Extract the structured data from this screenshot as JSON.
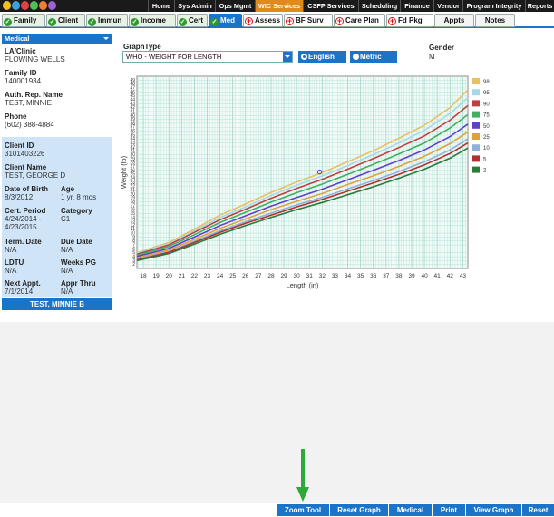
{
  "topnav": [
    "Home",
    "Sys Admin",
    "Ops Mgmt",
    "WIC Services",
    "CSFP Services",
    "Scheduling",
    "Finance",
    "Vendor",
    "Program Integrity",
    "Reports"
  ],
  "tabs": [
    "Family",
    "Client",
    "Immun",
    "Income",
    "Cert",
    "Med",
    "Assess",
    "BF Surv",
    "Care Plan",
    "Fd Pkg",
    "Appts",
    "Notes"
  ],
  "sidebar": {
    "header": "Medical",
    "la_label": "LA/Clinic",
    "la_value": "FLOWING WELLS",
    "family_label": "Family ID",
    "family_value": "140001934",
    "auth_label": "Auth. Rep. Name",
    "auth_value": "TEST, MINNIE",
    "phone_label": "Phone",
    "phone_value": "(602) 388-4884",
    "client_id_label": "Client ID",
    "client_id_value": "3101403226",
    "client_name_label": "Client Name",
    "client_name_value": "TEST, GEORGE D",
    "dob_label": "Date of Birth",
    "dob_value": "8/3/2012",
    "age_label": "Age",
    "age_value": "1 yr, 8 mos",
    "cert_label": "Cert. Period",
    "cert_value1": "4/24/2014 -",
    "cert_value2": "4/23/2015",
    "category_label": "Category",
    "category_value": "C1",
    "term_label": "Term. Date",
    "term_value": "N/A",
    "due_label": "Due Date",
    "due_value": "N/A",
    "ldtu_label": "LDTU",
    "ldtu_value": "N/A",
    "weeks_label": "Weeks PG",
    "weeks_value": "N/A",
    "next_label": "Next Appt.",
    "next_value": "7/1/2014",
    "appr_label": "Appr Thru",
    "appr_value": "N/A",
    "footer": "TEST, MINNIE B"
  },
  "main": {
    "graphtype_label": "GraphType",
    "graphtype_value": "WHO - WEIGHT FOR LENGTH",
    "english_label": "English",
    "metric_label": "Metric",
    "gender_label": "Gender",
    "gender_value": "M"
  },
  "chart_data": {
    "type": "line",
    "xlabel": "Length (in)",
    "ylabel": "Weight (lb)",
    "xlim": [
      17.5,
      43.4
    ],
    "ylim": [
      1,
      50
    ],
    "x_ticks": [
      18,
      19,
      20,
      21,
      22,
      23,
      24,
      25,
      26,
      27,
      28,
      29,
      30,
      31,
      32,
      33,
      34,
      35,
      36,
      37,
      38,
      39,
      40,
      41,
      42,
      43
    ],
    "y_ticks": [
      2,
      3,
      4,
      5,
      6,
      7,
      8,
      9,
      10,
      11,
      12,
      13,
      14,
      15,
      16,
      17,
      18,
      19,
      20,
      21,
      22,
      23,
      24,
      25,
      26,
      27,
      28,
      29,
      30,
      31,
      32,
      33,
      34,
      35,
      36,
      37,
      38,
      39,
      40,
      41,
      42,
      43,
      44,
      45,
      46,
      47,
      48,
      49
    ],
    "grid": true,
    "legend_position": "right",
    "series": [
      {
        "name": "98",
        "color": "#e8c060",
        "values": [
          [
            17.5,
            5.0
          ],
          [
            20,
            7.6
          ],
          [
            22,
            11.0
          ],
          [
            24,
            14.6
          ],
          [
            26,
            17.4
          ],
          [
            28,
            20.4
          ],
          [
            30,
            23.0
          ],
          [
            32,
            25.4
          ],
          [
            34,
            28.2
          ],
          [
            36,
            31.0
          ],
          [
            38,
            34.2
          ],
          [
            40,
            37.5
          ],
          [
            42,
            42.0
          ],
          [
            43.4,
            46.5
          ]
        ]
      },
      {
        "name": "95",
        "color": "#a8d8e8",
        "values": [
          [
            17.5,
            4.8
          ],
          [
            20,
            7.3
          ],
          [
            22,
            10.6
          ],
          [
            24,
            14.0
          ],
          [
            26,
            16.7
          ],
          [
            28,
            19.6
          ],
          [
            30,
            22.2
          ],
          [
            32,
            24.6
          ],
          [
            34,
            27.2
          ],
          [
            36,
            30.0
          ],
          [
            38,
            33.0
          ],
          [
            40,
            36.2
          ],
          [
            42,
            40.5
          ],
          [
            43.4,
            44.5
          ]
        ]
      },
      {
        "name": "90",
        "color": "#c04040",
        "values": [
          [
            17.5,
            4.6
          ],
          [
            20,
            7.0
          ],
          [
            22,
            10.2
          ],
          [
            24,
            13.4
          ],
          [
            26,
            16.1
          ],
          [
            28,
            18.9
          ],
          [
            30,
            21.4
          ],
          [
            32,
            23.7
          ],
          [
            34,
            26.3
          ],
          [
            36,
            29.0
          ],
          [
            38,
            31.8
          ],
          [
            40,
            34.8
          ],
          [
            42,
            38.8
          ],
          [
            43.4,
            42.5
          ]
        ]
      },
      {
        "name": "75",
        "color": "#40b060",
        "values": [
          [
            17.5,
            4.3
          ],
          [
            20,
            6.6
          ],
          [
            22,
            9.6
          ],
          [
            24,
            12.7
          ],
          [
            26,
            15.3
          ],
          [
            28,
            17.9
          ],
          [
            30,
            20.3
          ],
          [
            32,
            22.5
          ],
          [
            34,
            25.0
          ],
          [
            36,
            27.5
          ],
          [
            38,
            30.2
          ],
          [
            40,
            33.0
          ],
          [
            42,
            36.8
          ],
          [
            43.4,
            40.2
          ]
        ]
      },
      {
        "name": "50",
        "color": "#6040d0",
        "values": [
          [
            17.5,
            4.0
          ],
          [
            20,
            6.1
          ],
          [
            22,
            9.0
          ],
          [
            24,
            11.9
          ],
          [
            26,
            14.4
          ],
          [
            28,
            16.9
          ],
          [
            30,
            19.1
          ],
          [
            32,
            21.2
          ],
          [
            34,
            23.6
          ],
          [
            36,
            26.0
          ],
          [
            38,
            28.5
          ],
          [
            40,
            31.2
          ],
          [
            42,
            34.6
          ],
          [
            43.4,
            37.8
          ]
        ]
      },
      {
        "name": "25",
        "color": "#e0a040",
        "values": [
          [
            17.5,
            3.7
          ],
          [
            20,
            5.7
          ],
          [
            22,
            8.4
          ],
          [
            24,
            11.2
          ],
          [
            26,
            13.6
          ],
          [
            28,
            16.0
          ],
          [
            30,
            18.1
          ],
          [
            32,
            20.1
          ],
          [
            34,
            22.4
          ],
          [
            36,
            24.6
          ],
          [
            38,
            27.0
          ],
          [
            40,
            29.6
          ],
          [
            42,
            32.8
          ],
          [
            43.4,
            35.8
          ]
        ]
      },
      {
        "name": "10",
        "color": "#90b0d8",
        "values": [
          [
            17.5,
            3.4
          ],
          [
            20,
            5.3
          ],
          [
            22,
            7.9
          ],
          [
            24,
            10.6
          ],
          [
            26,
            12.9
          ],
          [
            28,
            15.1
          ],
          [
            30,
            17.2
          ],
          [
            32,
            19.1
          ],
          [
            34,
            21.3
          ],
          [
            36,
            23.4
          ],
          [
            38,
            25.7
          ],
          [
            40,
            28.2
          ],
          [
            42,
            31.2
          ],
          [
            43.4,
            34.0
          ]
        ]
      },
      {
        "name": "5",
        "color": "#b03030",
        "values": [
          [
            17.5,
            3.2
          ],
          [
            20,
            5.1
          ],
          [
            22,
            7.6
          ],
          [
            24,
            10.2
          ],
          [
            26,
            12.5
          ],
          [
            28,
            14.6
          ],
          [
            30,
            16.7
          ],
          [
            32,
            18.6
          ],
          [
            34,
            20.7
          ],
          [
            36,
            22.8
          ],
          [
            38,
            25.0
          ],
          [
            40,
            27.4
          ],
          [
            42,
            30.3
          ],
          [
            43.4,
            33.0
          ]
        ]
      },
      {
        "name": "2",
        "color": "#2a7a3a",
        "values": [
          [
            17.5,
            3.0
          ],
          [
            20,
            4.8
          ],
          [
            22,
            7.2
          ],
          [
            24,
            9.7
          ],
          [
            26,
            11.9
          ],
          [
            28,
            14.0
          ],
          [
            30,
            16.0
          ],
          [
            32,
            17.8
          ],
          [
            34,
            19.8
          ],
          [
            36,
            21.8
          ],
          [
            38,
            24.0
          ],
          [
            40,
            26.3
          ],
          [
            42,
            29.1
          ],
          [
            43.4,
            31.7
          ]
        ]
      }
    ],
    "points": [
      {
        "x": 31.8,
        "y": 25.6
      }
    ]
  },
  "bottombar": [
    "Zoom Tool",
    "Reset Graph",
    "Medical",
    "Print",
    "View Graph",
    "Reset"
  ],
  "colors": {
    "accent": "#1c74c8",
    "active_nav": "#e08a17",
    "arrow": "#2fa83a"
  }
}
